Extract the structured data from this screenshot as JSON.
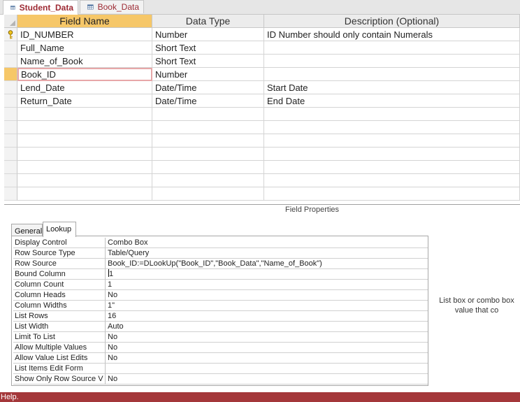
{
  "tabs": [
    {
      "label": "Student_Data",
      "active": true
    },
    {
      "label": "Book_Data",
      "active": false
    }
  ],
  "grid": {
    "headers": [
      "Field Name",
      "Data Type",
      "Description (Optional)"
    ],
    "rows": [
      {
        "field": "ID_NUMBER",
        "type": "Number",
        "desc": "ID Number should only contain Numerals",
        "primary_key": true
      },
      {
        "field": "Full_Name",
        "type": "Short Text",
        "desc": ""
      },
      {
        "field": "Name_of_Book",
        "type": "Short Text",
        "desc": ""
      },
      {
        "field": "Book_ID",
        "type": "Number",
        "desc": "",
        "current": true
      },
      {
        "field": "Lend_Date",
        "type": "Date/Time",
        "desc": "Start Date"
      },
      {
        "field": "Return_Date",
        "type": "Date/Time",
        "desc": "End Date"
      }
    ]
  },
  "field_properties": {
    "title": "Field Properties",
    "tabs": [
      "General",
      "Lookup"
    ],
    "active_tab": "Lookup",
    "rows": [
      {
        "name": "Display Control",
        "value": "Combo Box"
      },
      {
        "name": "Row Source Type",
        "value": "Table/Query"
      },
      {
        "name": "Row Source",
        "value": " Book_ID:=DLookUp(\"Book_ID\",\"Book_Data\",\"Name_of_Book\")"
      },
      {
        "name": "Bound Column",
        "value": "1"
      },
      {
        "name": "Column Count",
        "value": "1"
      },
      {
        "name": "Column Heads",
        "value": "No"
      },
      {
        "name": "Column Widths",
        "value": "1\""
      },
      {
        "name": "List Rows",
        "value": "16"
      },
      {
        "name": "List Width",
        "value": "Auto"
      },
      {
        "name": "Limit To List",
        "value": "No"
      },
      {
        "name": "Allow Multiple Values",
        "value": "No"
      },
      {
        "name": "Allow Value List Edits",
        "value": "No"
      },
      {
        "name": "List Items Edit Form",
        "value": ""
      },
      {
        "name": "Show Only Row Source V",
        "value": "No"
      }
    ]
  },
  "help_text": [
    "List box or combo box",
    "value that co"
  ],
  "status_text": "Help.",
  "colors": {
    "accent": "#a4373a",
    "selected_header": "#f6c768"
  }
}
